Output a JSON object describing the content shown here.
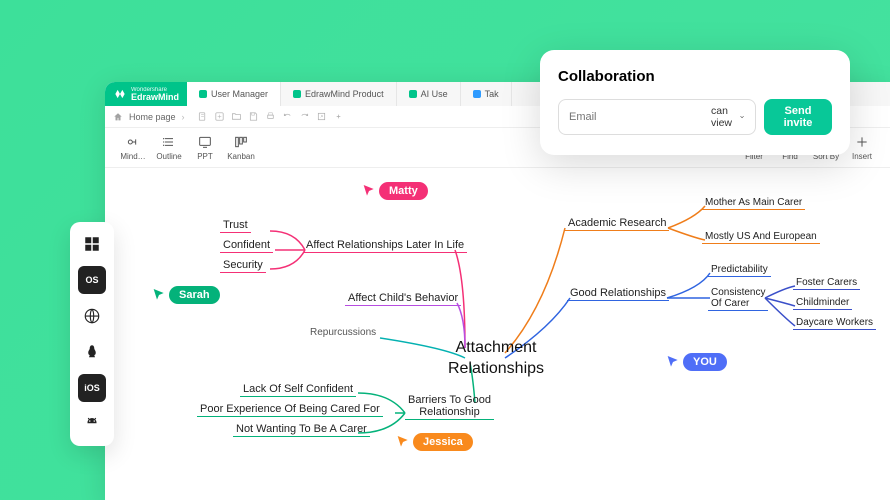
{
  "brand": {
    "top": "Wondershare",
    "name": "EdrawMind"
  },
  "tabs": [
    {
      "label": "User Manager",
      "active": true
    },
    {
      "label": "EdrawMind Product",
      "active": false
    },
    {
      "label": "AI Use",
      "active": false
    },
    {
      "label": "Tak",
      "active": false
    }
  ],
  "breadcrumb": {
    "home": "Home page"
  },
  "toolbar": {
    "left": [
      {
        "id": "mind",
        "label": "Mind…"
      },
      {
        "id": "outline",
        "label": "Outline"
      },
      {
        "id": "ppt",
        "label": "PPT"
      },
      {
        "id": "kanban",
        "label": "Kanban"
      }
    ],
    "right": [
      {
        "id": "filter",
        "label": "Filter"
      },
      {
        "id": "find",
        "label": "Find"
      },
      {
        "id": "sortby",
        "label": "Sort By"
      },
      {
        "id": "insert",
        "label": "Insert"
      }
    ]
  },
  "mindmap": {
    "center": "Attachment\nRelationships",
    "nodes": {
      "trust": "Trust",
      "confident": "Confident",
      "security": "Security",
      "affect_later": "Affect Relationships Later In Life",
      "affect_child": "Affect Child's Behavior",
      "repurcussions": "Repurcussions",
      "lack_conf": "Lack Of Self Confident",
      "poor_exp": "Poor Experience Of Being Cared For",
      "not_carer": "Not Wanting To Be A Carer",
      "barriers": "Barriers To Good\nRelationship",
      "academic": "Academic Research",
      "mother": "Mother As Main Carer",
      "mostly": "Mostly US And European",
      "good_rel": "Good Relationships",
      "predict": "Predictability",
      "consist": "Consistency\nOf Carer",
      "foster": "Foster Carers",
      "childminder": "Childminder",
      "daycare": "Daycare Workers"
    }
  },
  "cursors": {
    "matty": "Matty",
    "sarah": "Sarah",
    "jessica": "Jessica",
    "you": "YOU"
  },
  "collab": {
    "title": "Collaboration",
    "placeholder": "Email",
    "permission": "can view",
    "send": "Send invite"
  },
  "rail": [
    "windows",
    "macos",
    "web",
    "linux",
    "ios",
    "android"
  ],
  "colors": {
    "pink": "#f43076",
    "green": "#04b27a",
    "orange": "#f98a1d",
    "blue": "#4f6ef7",
    "violet": "#b74de0",
    "teal": "#04b1b1",
    "navy": "#3a4fc9",
    "dorange": "#ef7d1a",
    "dblue": "#2f64e0"
  }
}
